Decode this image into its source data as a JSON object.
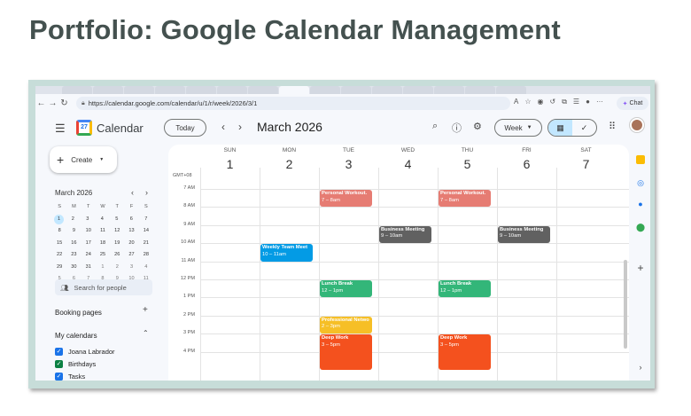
{
  "slide": {
    "title": "Portfolio: Google Calendar Management"
  },
  "browser": {
    "url": "https://calendar.google.com/calendar/u/1/r/week/2026/3/1",
    "chat_label": "Chat"
  },
  "header": {
    "app_name": "Calendar",
    "logo_day": "27",
    "today_label": "Today",
    "month_title": "March 2026",
    "view_label": "Week"
  },
  "sidebar": {
    "create_label": "Create",
    "mini_month": "March 2026",
    "weekday_initials": [
      "S",
      "M",
      "T",
      "W",
      "T",
      "F",
      "S"
    ],
    "mini_weeks": [
      [
        "1",
        "2",
        "3",
        "4",
        "5",
        "6",
        "7"
      ],
      [
        "8",
        "9",
        "10",
        "11",
        "12",
        "13",
        "14"
      ],
      [
        "15",
        "16",
        "17",
        "18",
        "19",
        "20",
        "21"
      ],
      [
        "22",
        "23",
        "24",
        "25",
        "26",
        "27",
        "28"
      ],
      [
        "29",
        "30",
        "31",
        "1",
        "2",
        "3",
        "4"
      ],
      [
        "5",
        "6",
        "7",
        "8",
        "9",
        "10",
        "11"
      ]
    ],
    "search_people": "Search for people",
    "booking_pages": "Booking pages",
    "my_calendars": "My calendars",
    "calendars": [
      {
        "name": "Joana Labrador",
        "color": "#1a73e8"
      },
      {
        "name": "Birthdays",
        "color": "#0b8043"
      },
      {
        "name": "Tasks",
        "color": "#1a73e8"
      }
    ]
  },
  "grid": {
    "timezone": "GMT+08",
    "days": [
      {
        "name": "SUN",
        "date": "1"
      },
      {
        "name": "MON",
        "date": "2"
      },
      {
        "name": "TUE",
        "date": "3"
      },
      {
        "name": "WED",
        "date": "4"
      },
      {
        "name": "THU",
        "date": "5"
      },
      {
        "name": "FRI",
        "date": "6"
      },
      {
        "name": "SAT",
        "date": "7"
      }
    ],
    "hours": [
      "7 AM",
      "8 AM",
      "9 AM",
      "10 AM",
      "11 AM",
      "12 PM",
      "1 PM",
      "2 PM",
      "3 PM",
      "4 PM"
    ],
    "events": [
      {
        "title": "Personal Workout.",
        "time": "7 – 8am",
        "day": 2,
        "start": 7,
        "end": 8,
        "color": "#e67c73"
      },
      {
        "title": "Personal Workout.",
        "time": "7 – 8am",
        "day": 4,
        "start": 7,
        "end": 8,
        "color": "#e67c73"
      },
      {
        "title": "Business Meeting",
        "time": "9 – 10am",
        "day": 3,
        "start": 9,
        "end": 10,
        "color": "#616161"
      },
      {
        "title": "Business Meeting",
        "time": "9 – 10am",
        "day": 5,
        "start": 9,
        "end": 10,
        "color": "#616161"
      },
      {
        "title": "Weekly Team Meet",
        "time": "10 – 11am",
        "day": 1,
        "start": 10,
        "end": 11,
        "color": "#039be5"
      },
      {
        "title": "Lunch Break",
        "time": "12 – 1pm",
        "day": 2,
        "start": 12,
        "end": 13,
        "color": "#33b679"
      },
      {
        "title": "Lunch Break",
        "time": "12 – 1pm",
        "day": 4,
        "start": 12,
        "end": 13,
        "color": "#33b679"
      },
      {
        "title": "Professional Netwo",
        "time": "2 – 3pm",
        "day": 2,
        "start": 14,
        "end": 15,
        "color": "#f6bf26"
      },
      {
        "title": "Deep Work",
        "time": "3 – 5pm",
        "day": 2,
        "start": 15,
        "end": 17,
        "color": "#f4511e"
      },
      {
        "title": "Deep Work",
        "time": "3 – 5pm",
        "day": 4,
        "start": 15,
        "end": 17,
        "color": "#f4511e"
      }
    ]
  },
  "icons": {
    "menu": "hamburger-icon",
    "search": "search-icon",
    "help": "help-icon",
    "settings": "gear-icon",
    "apps": "apps-grid-icon"
  }
}
